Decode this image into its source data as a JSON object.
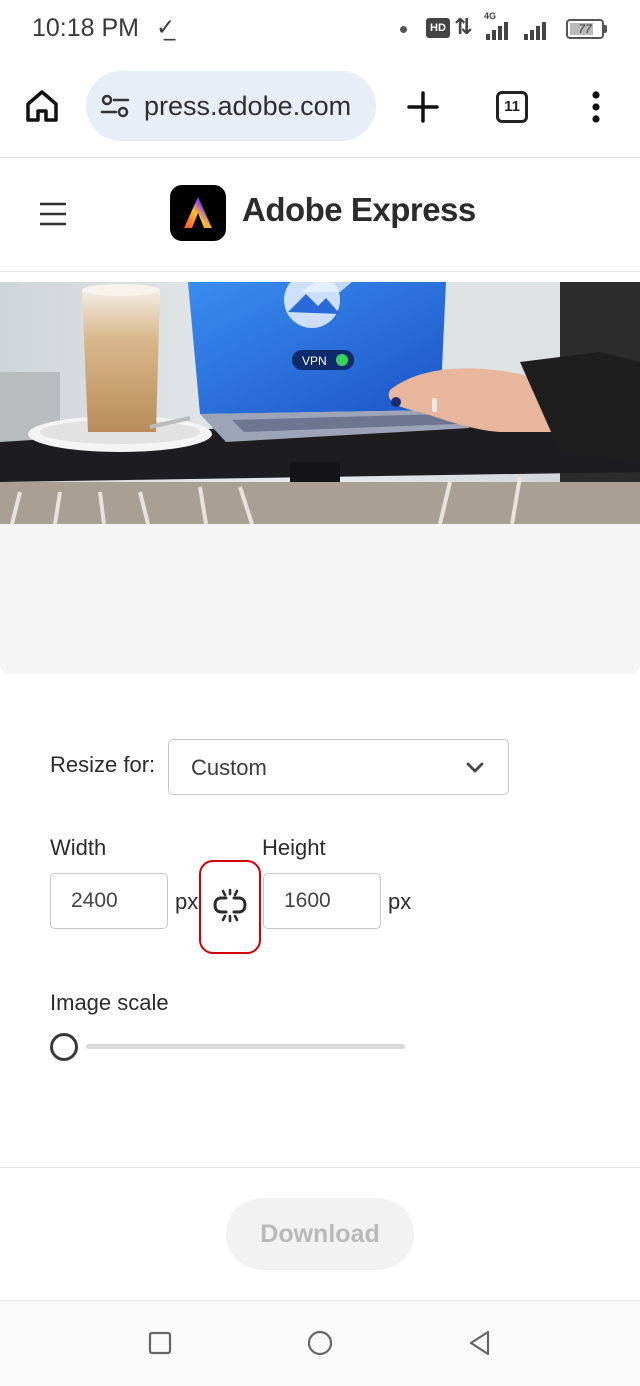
{
  "status_bar": {
    "time": "10:18 PM",
    "notification_icon": "download-done-icon",
    "hd_badge": "HD",
    "network_badge": "4G",
    "battery_level": "77",
    "battery_fraction": 0.77
  },
  "browser": {
    "url": "press.adobe.com",
    "tab_count": "11",
    "icons": [
      "home-icon",
      "tune-icon",
      "plus-icon",
      "tab-switcher-icon",
      "more-vert-icon"
    ]
  },
  "header": {
    "brand_name": "Adobe Express",
    "icons": [
      "hamburger-icon",
      "adobe-express-logo"
    ],
    "logo_colors": [
      "#ff4f2e",
      "#fbbe2d",
      "#8b3cf7",
      "#2dd4ff"
    ]
  },
  "form": {
    "resize_label": "Resize for:",
    "resize_value": "Custom",
    "width_label": "Width",
    "width_value": "2400",
    "width_unit": "px",
    "height_label": "Height",
    "height_value": "1600",
    "height_unit": "px",
    "link_icon": "unlinked-chain-icon",
    "scale_label": "Image scale",
    "scale_fraction": 0,
    "highlight_color": "#d40000"
  },
  "download": {
    "label": "Download"
  },
  "nav": {
    "icons": [
      "recents-square-icon",
      "home-circle-icon",
      "back-triangle-icon"
    ]
  }
}
